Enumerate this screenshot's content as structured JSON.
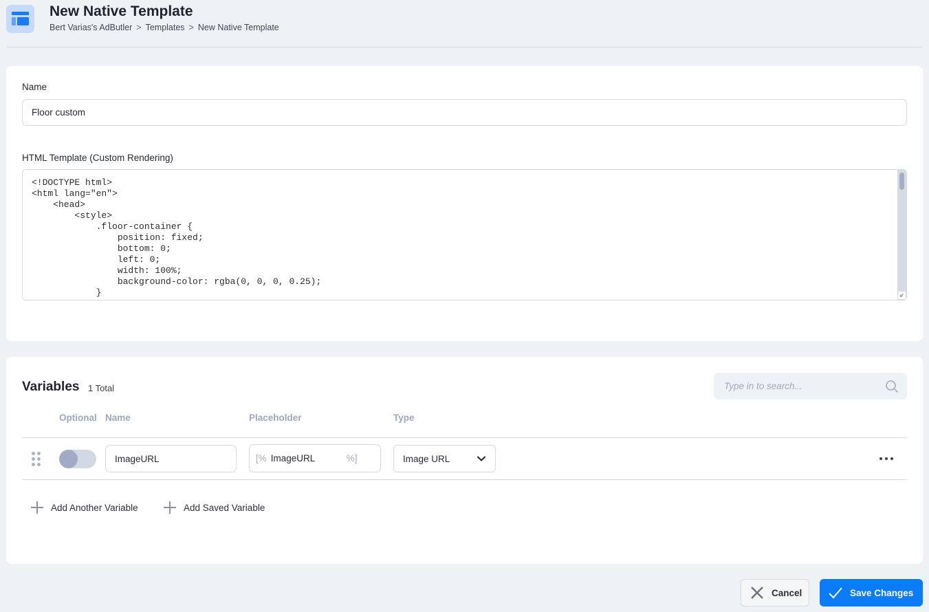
{
  "header": {
    "icon": "native-template-icon",
    "title": "New Native Template",
    "breadcrumb": [
      "Bert Varias's AdButler",
      "Templates",
      "New Native Template"
    ],
    "breadcrumb_separator": ">"
  },
  "form": {
    "name_label": "Name",
    "name_value": "Floor custom",
    "html_label": "HTML Template (Custom Rendering)",
    "html_value": "<!DOCTYPE html>\n<html lang=\"en\">\n    <head>\n        <style>\n            .floor-container {\n                position: fixed;\n                bottom: 0;\n                left: 0;\n                width: 100%;\n                background-color: rgba(0, 0, 0, 0.25);\n            }"
  },
  "variables": {
    "title": "Variables",
    "count_label": "1 Total",
    "search_placeholder": "Type in to search...",
    "columns": {
      "optional": "Optional",
      "name": "Name",
      "placeholder": "Placeholder",
      "type": "Type"
    },
    "rows": [
      {
        "optional": false,
        "name": "ImageURL",
        "placeholder_prefix": "[%",
        "placeholder_value": "ImageURL",
        "placeholder_suffix": "%]",
        "type": "Image URL"
      }
    ],
    "add_another_label": "Add Another Variable",
    "add_saved_label": "Add Saved Variable"
  },
  "actions": {
    "cancel_label": "Cancel",
    "save_label": "Save Changes"
  },
  "colors": {
    "accent": "#0a7cf8",
    "background": "#eff2f5",
    "muted_text": "#9ea7bd"
  }
}
